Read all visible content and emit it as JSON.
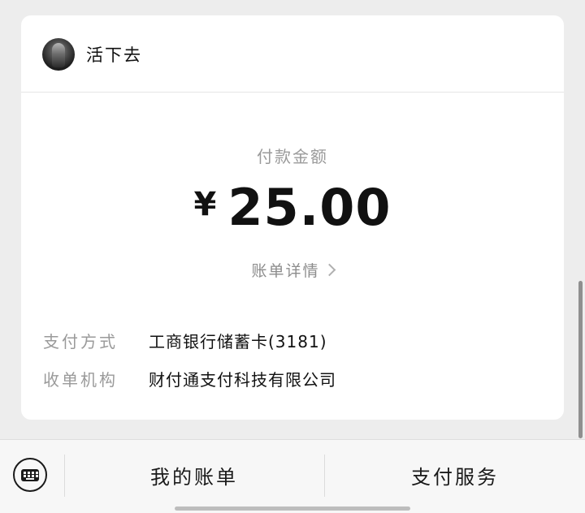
{
  "merchant": {
    "name": "活下去"
  },
  "payment": {
    "amount_label": "付款金额",
    "currency_symbol": "¥",
    "amount": "25.00",
    "bill_detail_label": "账单详情"
  },
  "details": [
    {
      "label": "支付方式",
      "value": "工商银行储蓄卡(3181)"
    },
    {
      "label": "收单机构",
      "value": "财付通支付科技有限公司"
    }
  ],
  "bottom_menu": {
    "keyboard_icon": "keyboard-icon",
    "items": [
      {
        "label": "我的账单"
      },
      {
        "label": "支付服务"
      }
    ]
  },
  "colors": {
    "background": "#ededed",
    "card": "#ffffff",
    "muted_text": "#9a9a9a",
    "primary_text": "#111111"
  }
}
